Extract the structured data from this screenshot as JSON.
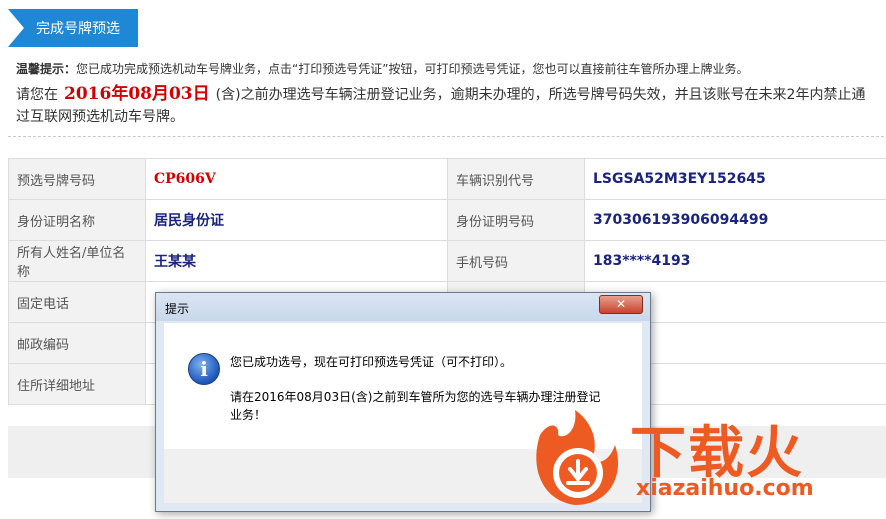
{
  "header": {
    "title": "完成号牌预选"
  },
  "tip": {
    "label": "温馨提示：",
    "text": "您已成功完成预选机动车号牌业务，点击“打印预选号凭证”按钮，可打印预选号凭证，您也可以直接前往车管所办理上牌业务。"
  },
  "notice": {
    "prefix": "请您在",
    "date": "2016年08月03日",
    "suffix": "(含)之前办理选号车辆注册登记业务，逾期未办理的，所选号牌号码失效，并且该账号在未来2年内禁止通过互联网预选机动车号牌。"
  },
  "table": {
    "rows": [
      {
        "l1": "预选号牌号码",
        "v1": "CP606V",
        "l2": "车辆识别代号",
        "v2": "LSGSA52M3EY152645"
      },
      {
        "l1": "身份证明名称",
        "v1": "居民身份证",
        "l2": "身份证明号码",
        "v2": "370306193906094499"
      },
      {
        "l1": "所有人姓名/单位名称",
        "v1": "王某某",
        "l2": "手机号码",
        "v2": "183****4193"
      },
      {
        "l1": "固定电话",
        "v1": "",
        "l2": "",
        "v2": ""
      },
      {
        "l1": "邮政编码",
        "v1": "",
        "l2": "",
        "v2": ""
      },
      {
        "l1": "住所详细地址",
        "v1": "",
        "l2": "",
        "v2": ""
      }
    ]
  },
  "dialog": {
    "title": "提示",
    "close_label": "✕",
    "icon": "info-icon",
    "message1": "您已成功选号，现在可打印预选号凭证（可不打印）。",
    "message2": "请在2016年08月03日(含)之前到车管所为您的选号车辆办理注册登记业务！"
  },
  "watermark": {
    "brand": "下载火",
    "url": "xiazaihuo.com"
  },
  "colors": {
    "accent": "#1e88d6",
    "red": "#d40000",
    "navy": "#1a237e",
    "brand_orange": "#ee5b22"
  }
}
